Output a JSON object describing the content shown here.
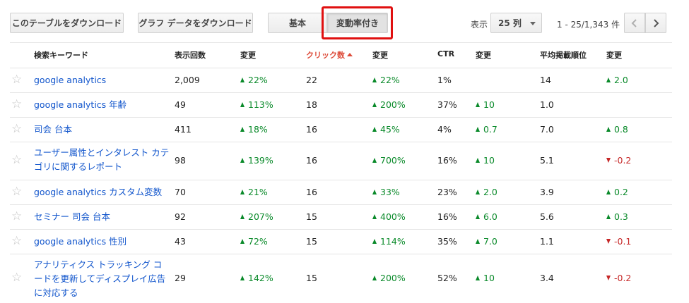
{
  "toolbar": {
    "download_table": "このテーブルをダウンロード",
    "download_chart": "グラフ データをダウンロード",
    "view_basic": "基本",
    "view_change": "変動率付き",
    "show_label": "表示",
    "rows_select": "25 列",
    "range": "1 - 25/1,343 件",
    "prev_icon": "chevron-left-icon",
    "next_icon": "chevron-right-icon"
  },
  "colors": {
    "highlight": "#e01010",
    "link": "#1155cc",
    "up": "#0a8a2a",
    "down": "#c62828",
    "sorted_header": "#dd4b39"
  },
  "headers": {
    "keyword": "検索キーワード",
    "impressions": "表示回数",
    "imp_change": "変更",
    "clicks": "クリック数",
    "click_change": "変更",
    "ctr": "CTR",
    "ctr_change": "変更",
    "position": "平均掲載順位",
    "pos_change": "変更"
  },
  "rows": [
    {
      "keyword": "google analytics",
      "impressions": "2,009",
      "imp_change": "22%",
      "imp_dir": "up",
      "clicks": "22",
      "click_change": "22%",
      "click_dir": "up",
      "ctr": "1%",
      "ctr_change": "",
      "ctr_dir": "",
      "position": "14",
      "pos_change": "2.0",
      "pos_dir": "up"
    },
    {
      "keyword": "google analytics 年齢",
      "impressions": "49",
      "imp_change": "113%",
      "imp_dir": "up",
      "clicks": "18",
      "click_change": "200%",
      "click_dir": "up",
      "ctr": "37%",
      "ctr_change": "10",
      "ctr_dir": "up",
      "position": "1.0",
      "pos_change": "",
      "pos_dir": ""
    },
    {
      "keyword": "司会 台本",
      "impressions": "411",
      "imp_change": "18%",
      "imp_dir": "up",
      "clicks": "16",
      "click_change": "45%",
      "click_dir": "up",
      "ctr": "4%",
      "ctr_change": "0.7",
      "ctr_dir": "up",
      "position": "7.0",
      "pos_change": "0.8",
      "pos_dir": "up"
    },
    {
      "keyword": "ユーザー属性とインタレスト カテゴリに関するレポート",
      "impressions": "98",
      "imp_change": "139%",
      "imp_dir": "up",
      "clicks": "16",
      "click_change": "700%",
      "click_dir": "up",
      "ctr": "16%",
      "ctr_change": "10",
      "ctr_dir": "up",
      "position": "5.1",
      "pos_change": "-0.2",
      "pos_dir": "down"
    },
    {
      "keyword": "google analytics カスタム変数",
      "impressions": "70",
      "imp_change": "21%",
      "imp_dir": "up",
      "clicks": "16",
      "click_change": "33%",
      "click_dir": "up",
      "ctr": "23%",
      "ctr_change": "2.0",
      "ctr_dir": "up",
      "position": "3.9",
      "pos_change": "0.2",
      "pos_dir": "up"
    },
    {
      "keyword": "セミナー 司会 台本",
      "impressions": "92",
      "imp_change": "207%",
      "imp_dir": "up",
      "clicks": "15",
      "click_change": "400%",
      "click_dir": "up",
      "ctr": "16%",
      "ctr_change": "6.0",
      "ctr_dir": "up",
      "position": "5.6",
      "pos_change": "0.3",
      "pos_dir": "up"
    },
    {
      "keyword": "google analytics 性別",
      "impressions": "43",
      "imp_change": "72%",
      "imp_dir": "up",
      "clicks": "15",
      "click_change": "114%",
      "click_dir": "up",
      "ctr": "35%",
      "ctr_change": "7.0",
      "ctr_dir": "up",
      "position": "1.1",
      "pos_change": "-0.1",
      "pos_dir": "down"
    },
    {
      "keyword": "アナリティクス トラッキング コードを更新してディスプレイ広告に対応する",
      "impressions": "29",
      "imp_change": "142%",
      "imp_dir": "up",
      "clicks": "15",
      "click_change": "200%",
      "click_dir": "up",
      "ctr": "52%",
      "ctr_change": "10",
      "ctr_dir": "up",
      "position": "3.4",
      "pos_change": "-0.2",
      "pos_dir": "down"
    }
  ]
}
